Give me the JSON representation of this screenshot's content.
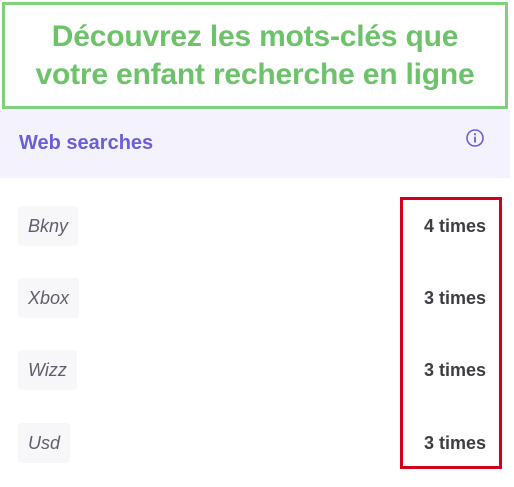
{
  "callout": {
    "line1": "Découvrez les mots-clés que",
    "line2": "votre enfant recherche en ligne"
  },
  "section": {
    "title": "Web searches",
    "info_icon": "info-circle-icon"
  },
  "searches": [
    {
      "term": "Bkny",
      "count": "4 times"
    },
    {
      "term": "Xbox",
      "count": "3 times"
    },
    {
      "term": "Wizz",
      "count": "3 times"
    },
    {
      "term": "Usd",
      "count": "3 times"
    }
  ],
  "colors": {
    "callout_green": "#6cc36a",
    "header_purple": "#6b5ed8",
    "highlight_red": "#d0021b"
  }
}
